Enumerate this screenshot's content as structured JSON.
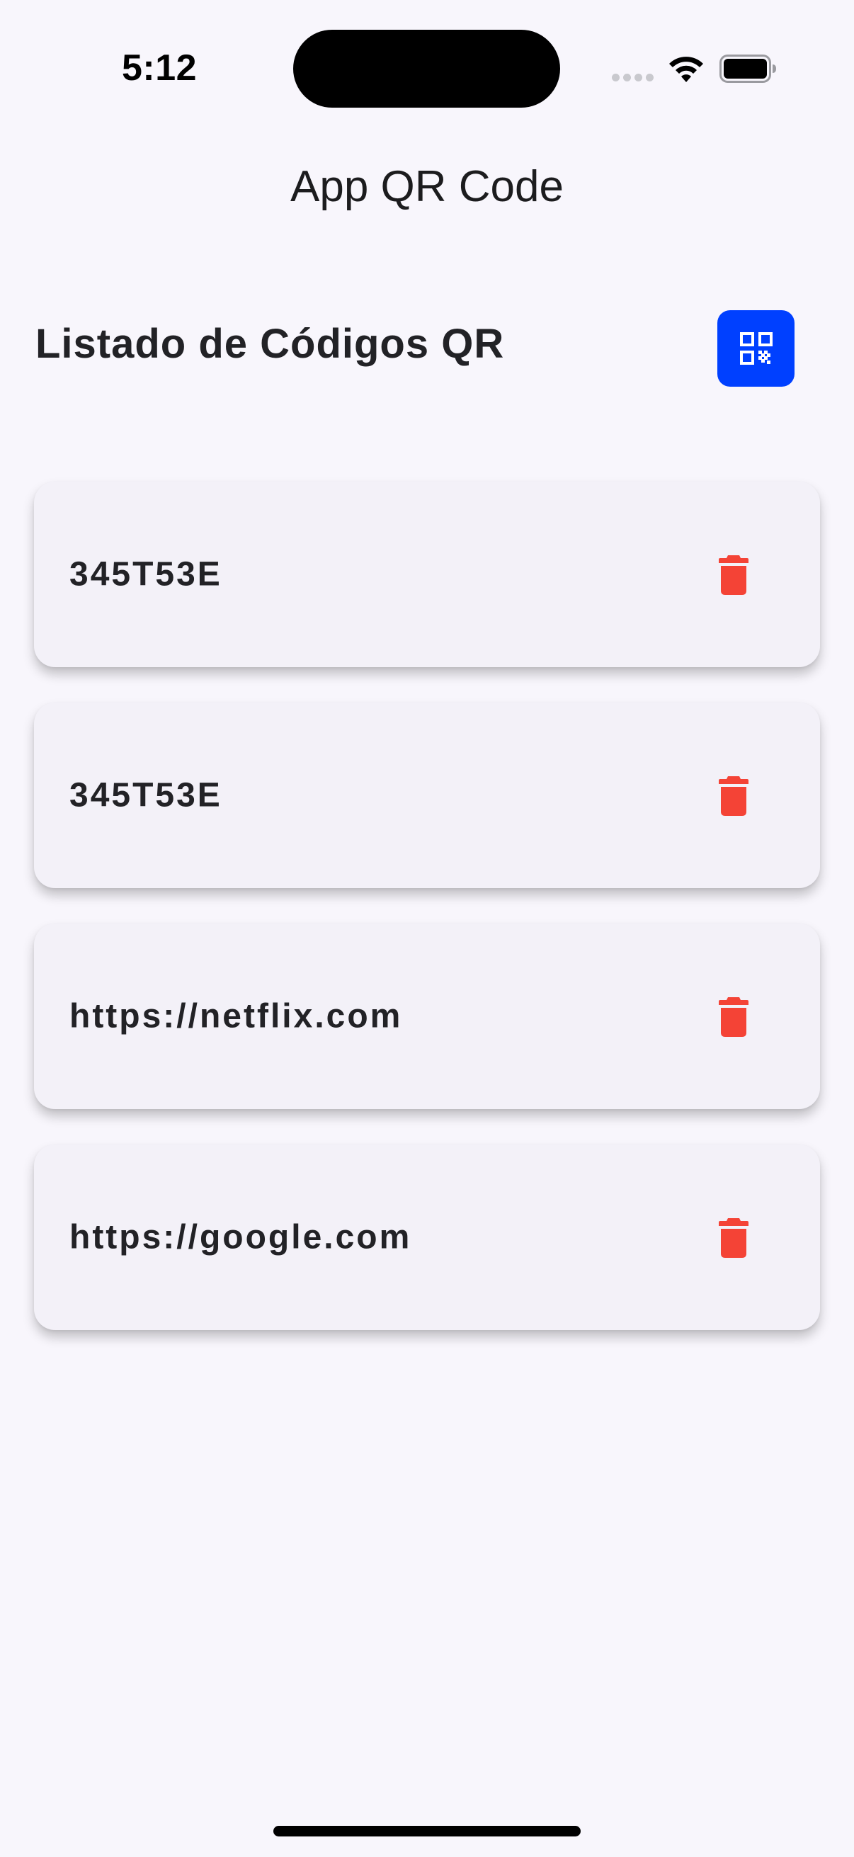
{
  "status_bar": {
    "time": "5:12"
  },
  "header": {
    "app_title": "App QR Code"
  },
  "section": {
    "title": "Listado de Códigos QR",
    "scan_button_icon": "qr-code-icon"
  },
  "qr_list": [
    {
      "text": "345T53E",
      "action_icon": "trash-icon"
    },
    {
      "text": "345T53E",
      "action_icon": "trash-icon"
    },
    {
      "text": "https://netflix.com",
      "action_icon": "trash-icon"
    },
    {
      "text": "https://google.com",
      "action_icon": "trash-icon"
    }
  ],
  "colors": {
    "background": "#f8f6fc",
    "card": "#f3f1f8",
    "accent": "#0040ff",
    "delete": "#f44336",
    "text": "#222226"
  }
}
